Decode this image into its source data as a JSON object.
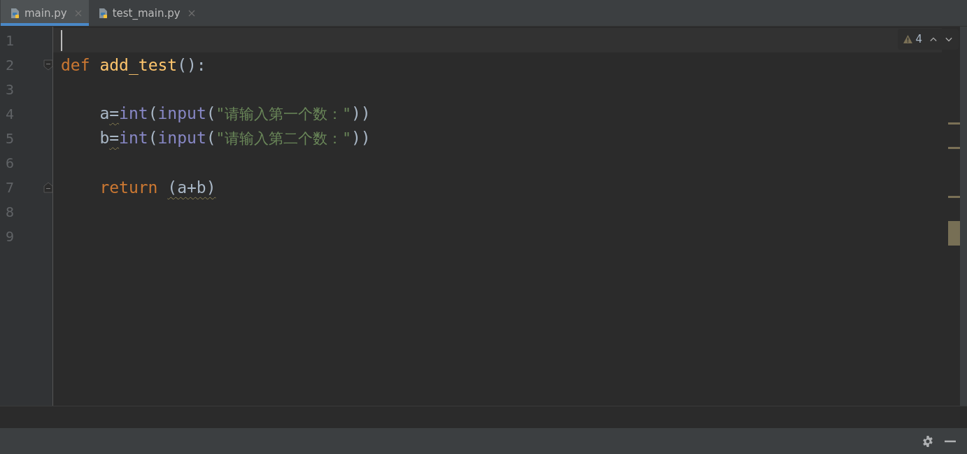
{
  "tabs": [
    {
      "label": "main.py",
      "selected": true
    },
    {
      "label": "test_main.py",
      "selected": false
    }
  ],
  "inspection": {
    "count": "4"
  },
  "editor": {
    "lines": [
      {
        "number": "1",
        "current": true
      },
      {
        "number": "2",
        "fold_start": true,
        "tokens": [
          {
            "text": "def",
            "kind": "keyword"
          },
          {
            "text": "add_test",
            "kind": "funcname",
            "gap": true
          },
          {
            "text": "():",
            "kind": "plain"
          }
        ]
      },
      {
        "number": "3"
      },
      {
        "number": "4",
        "indented": true,
        "tokens": [
          {
            "text": "a",
            "kind": "plain"
          },
          {
            "text": "=",
            "kind": "plain",
            "warn": true
          },
          {
            "text": "int",
            "kind": "builtin"
          },
          {
            "text": "(",
            "kind": "plain"
          },
          {
            "text": "input",
            "kind": "builtin"
          },
          {
            "text": "(",
            "kind": "plain"
          },
          {
            "text": "\"请输入第一个数：\"",
            "kind": "string"
          },
          {
            "text": "))",
            "kind": "plain"
          }
        ]
      },
      {
        "number": "5",
        "indented": true,
        "tokens": [
          {
            "text": "b",
            "kind": "plain"
          },
          {
            "text": "=",
            "kind": "plain",
            "warn": true
          },
          {
            "text": "int",
            "kind": "builtin"
          },
          {
            "text": "(",
            "kind": "plain"
          },
          {
            "text": "input",
            "kind": "builtin"
          },
          {
            "text": "(",
            "kind": "plain"
          },
          {
            "text": "\"请输入第二个数：\"",
            "kind": "string"
          },
          {
            "text": "))",
            "kind": "plain"
          }
        ]
      },
      {
        "number": "6"
      },
      {
        "number": "7",
        "indented": true,
        "fold_end": true,
        "tokens": [
          {
            "text": "return",
            "kind": "keyword"
          },
          {
            "text": "(a+b)",
            "kind": "plain",
            "warn": true,
            "gap": true
          }
        ]
      },
      {
        "number": "8"
      },
      {
        "number": "9"
      }
    ]
  }
}
